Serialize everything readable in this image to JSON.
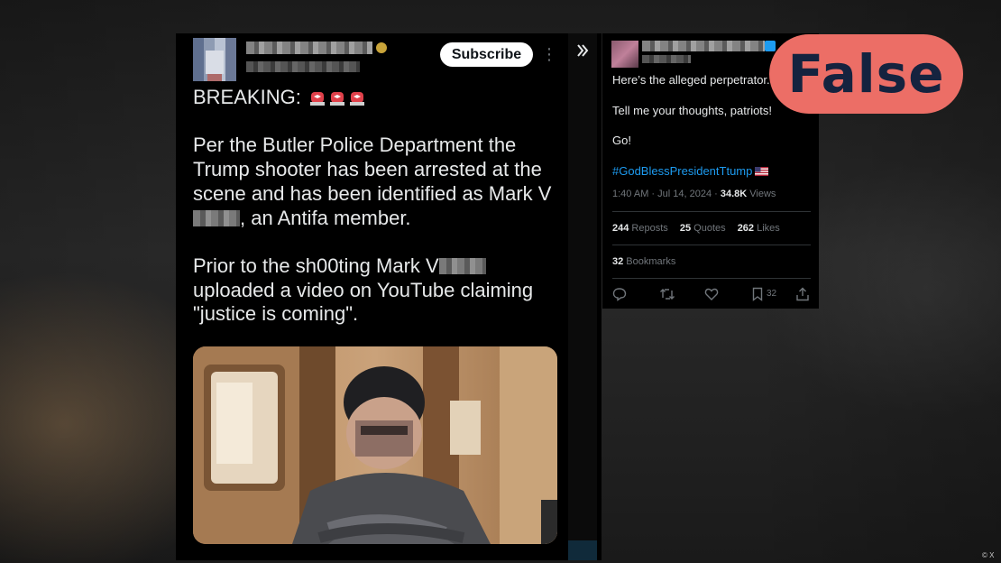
{
  "left_post": {
    "subscribe_label": "Subscribe",
    "more_label": "⋮",
    "line_breaking": "BREAKING:",
    "p2_before_redaction": "Per the Butler Police Department the Trump shooter has been arrested at the scene and has been identified as Mark V",
    "p2_after_redaction": ", an Antifa member.",
    "p3_before_redaction": "Prior to the sh00ting Mark V",
    "p3_after_redaction": "uploaded a video on YouTube claiming \"justice is coming\"."
  },
  "right_post": {
    "line1": "Here’s the alleged perpetrator.",
    "line2": "Tell me your thoughts, patriots!",
    "line3": "Go!",
    "hashtag": "#GodBlessPresidentTtump",
    "time_date": "1:40 AM · Jul 14, 2024 · ",
    "views_count": "34.8K",
    "views_label": " Views",
    "reposts_count": "244",
    "reposts_label": " Reposts",
    "quotes_count": "25",
    "quotes_label": " Quotes",
    "likes_count": "262",
    "likes_label": " Likes",
    "bookmarks_count": "32",
    "bookmarks_label": " Bookmarks",
    "bookmark_action_count": "32"
  },
  "verdict": {
    "label": "False",
    "color": "#ec6e66"
  },
  "credit": "© X",
  "colors": {
    "link": "#1d9bf0",
    "muted": "#71767b",
    "text": "#e7e9ea"
  }
}
